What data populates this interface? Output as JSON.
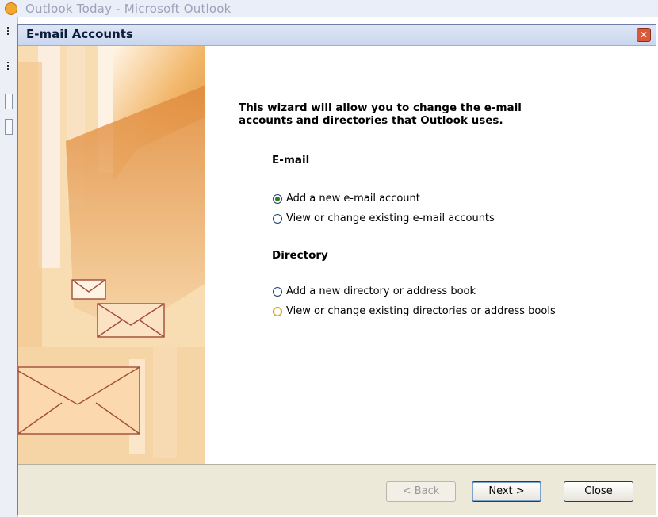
{
  "background_window": {
    "title": "Outlook Today - Microsoft Outlook"
  },
  "dialog": {
    "title": "E-mail Accounts",
    "heading": "This wizard will allow you to change the e-mail accounts and directories that Outlook uses.",
    "sections": {
      "email": {
        "label": "E-mail",
        "options": [
          {
            "label": "Add a new e-mail account",
            "selected": true
          },
          {
            "label": "View or change existing e-mail accounts",
            "selected": false
          }
        ]
      },
      "directory": {
        "label": "Directory",
        "options": [
          {
            "label": "Add a new directory or address book",
            "selected": false
          },
          {
            "label": "View or change existing directories or address bools",
            "selected": false
          }
        ]
      }
    },
    "buttons": {
      "back": "< Back",
      "next": "Next >",
      "close": "Close"
    }
  },
  "colors": {
    "art_orange": "#f0b56a",
    "selected_radio": "#2d7c2d",
    "hover_radio": "#f2cf5b"
  }
}
